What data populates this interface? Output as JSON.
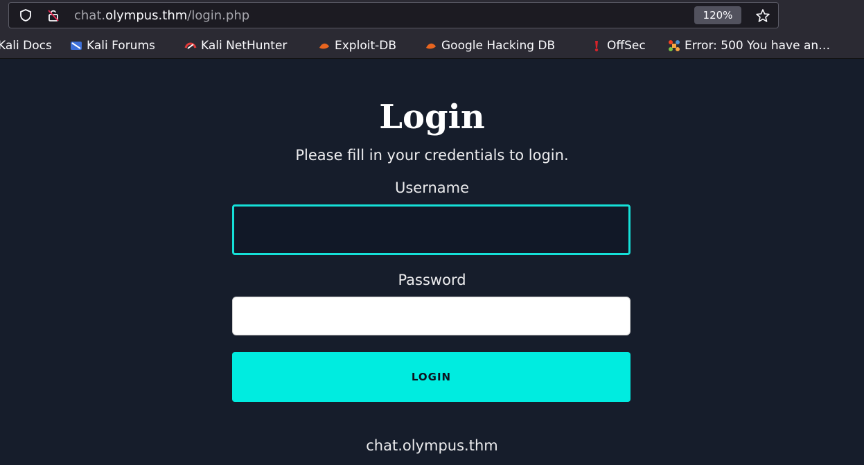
{
  "browser": {
    "url_prefix": "chat.",
    "url_host": "olympus.thm",
    "url_path": "/login.php",
    "zoom": "120%",
    "icons": [
      "shield-icon",
      "lock-insecure-icon",
      "bookmark-star-icon"
    ]
  },
  "bookmarks": [
    {
      "label": "Kali Docs",
      "icon": "kali-docs-icon"
    },
    {
      "label": "Kali Forums",
      "icon": "kali-forums-icon"
    },
    {
      "label": "Kali NetHunter",
      "icon": "kali-nethunter-icon"
    },
    {
      "label": "Exploit-DB",
      "icon": "exploit-db-icon"
    },
    {
      "label": "Google Hacking DB",
      "icon": "google-hacking-db-icon"
    },
    {
      "label": "OffSec",
      "icon": "offsec-icon"
    },
    {
      "label": "Error: 500 You have an…",
      "icon": "joomla-icon"
    }
  ],
  "login": {
    "title": "Login",
    "subtitle": "Please fill in your credentials to login.",
    "username_label": "Username",
    "username_value": "",
    "password_label": "Password",
    "password_value": "",
    "button_label": "LOGIN",
    "footer": "chat.olympus.thm"
  },
  "colors": {
    "page_bg": "#161d2b",
    "accent": "#00ece0",
    "focus_border": "#15e0d8",
    "browser_chrome": "#2b2a33"
  }
}
